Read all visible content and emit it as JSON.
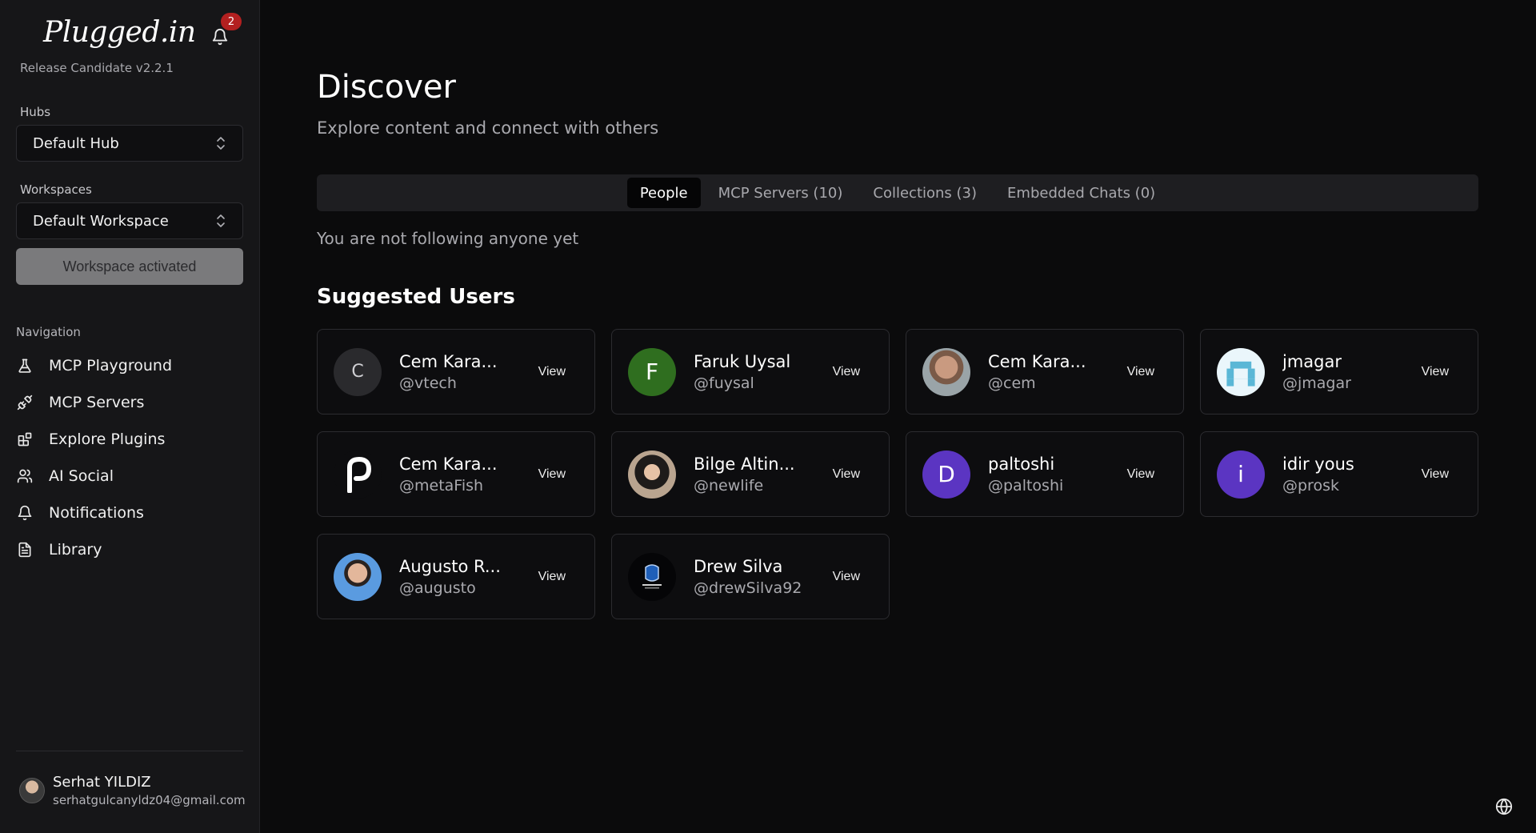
{
  "app": {
    "logo": "Plugged.in",
    "version": "Release Candidate v2.2.1",
    "notification_count": "2"
  },
  "sidebar": {
    "hubs_label": "Hubs",
    "hub_value": "Default Hub",
    "workspaces_label": "Workspaces",
    "workspace_value": "Default Workspace",
    "workspace_button": "Workspace activated",
    "nav_label": "Navigation",
    "nav_items": [
      {
        "label": "MCP Playground",
        "icon": "flask-icon"
      },
      {
        "label": "MCP Servers",
        "icon": "plug-icon"
      },
      {
        "label": "Explore Plugins",
        "icon": "blocks-icon"
      },
      {
        "label": "AI Social",
        "icon": "users-icon"
      },
      {
        "label": "Notifications",
        "icon": "bell-icon"
      },
      {
        "label": "Library",
        "icon": "document-icon"
      }
    ],
    "user": {
      "name": "Serhat YILDIZ",
      "email": "serhatgulcanyldz04@gmail.com"
    }
  },
  "main": {
    "title": "Discover",
    "subtitle": "Explore content and connect with others",
    "tabs": [
      {
        "label": "People",
        "active": true
      },
      {
        "label": "MCP Servers (10)",
        "active": false
      },
      {
        "label": "Collections (3)",
        "active": false
      },
      {
        "label": "Embedded Chats (0)",
        "active": false
      }
    ],
    "empty_following": "You are not following anyone yet",
    "suggested_title": "Suggested Users",
    "view_label": "View",
    "users": [
      {
        "name": "Cem Kara...",
        "handle": "@vtech",
        "initial": "C",
        "color": "#2a2a2d",
        "avatar": "initial"
      },
      {
        "name": "Faruk Uysal",
        "handle": "@fuysal",
        "initial": "F",
        "color": "#2f6e1f",
        "avatar": "initial"
      },
      {
        "name": "Cem Kara...",
        "handle": "@cem",
        "initial": "",
        "color": "#6b6b6b",
        "avatar": "photo-man"
      },
      {
        "name": "jmagar",
        "handle": "@jmagar",
        "initial": "",
        "color": "#eaf6fb",
        "avatar": "pixel"
      },
      {
        "name": "Cem Kara...",
        "handle": "@metaFish",
        "initial": "",
        "color": "#0d0d0f",
        "avatar": "logo-p"
      },
      {
        "name": "Bilge Altin...",
        "handle": "@newlife",
        "initial": "",
        "color": "#8b7a6a",
        "avatar": "photo-woman"
      },
      {
        "name": "paltoshi",
        "handle": "@paltoshi",
        "initial": "D",
        "color": "#5b35c2",
        "avatar": "initial"
      },
      {
        "name": "idir yous",
        "handle": "@prosk",
        "initial": "i",
        "color": "#5b35c2",
        "avatar": "initial"
      },
      {
        "name": "Augusto R...",
        "handle": "@augusto",
        "initial": "",
        "color": "#4b87d6",
        "avatar": "photo-augusto"
      },
      {
        "name": "Drew Silva",
        "handle": "@drewSilva92",
        "initial": "",
        "color": "#050507",
        "avatar": "logo-helmet"
      }
    ]
  }
}
